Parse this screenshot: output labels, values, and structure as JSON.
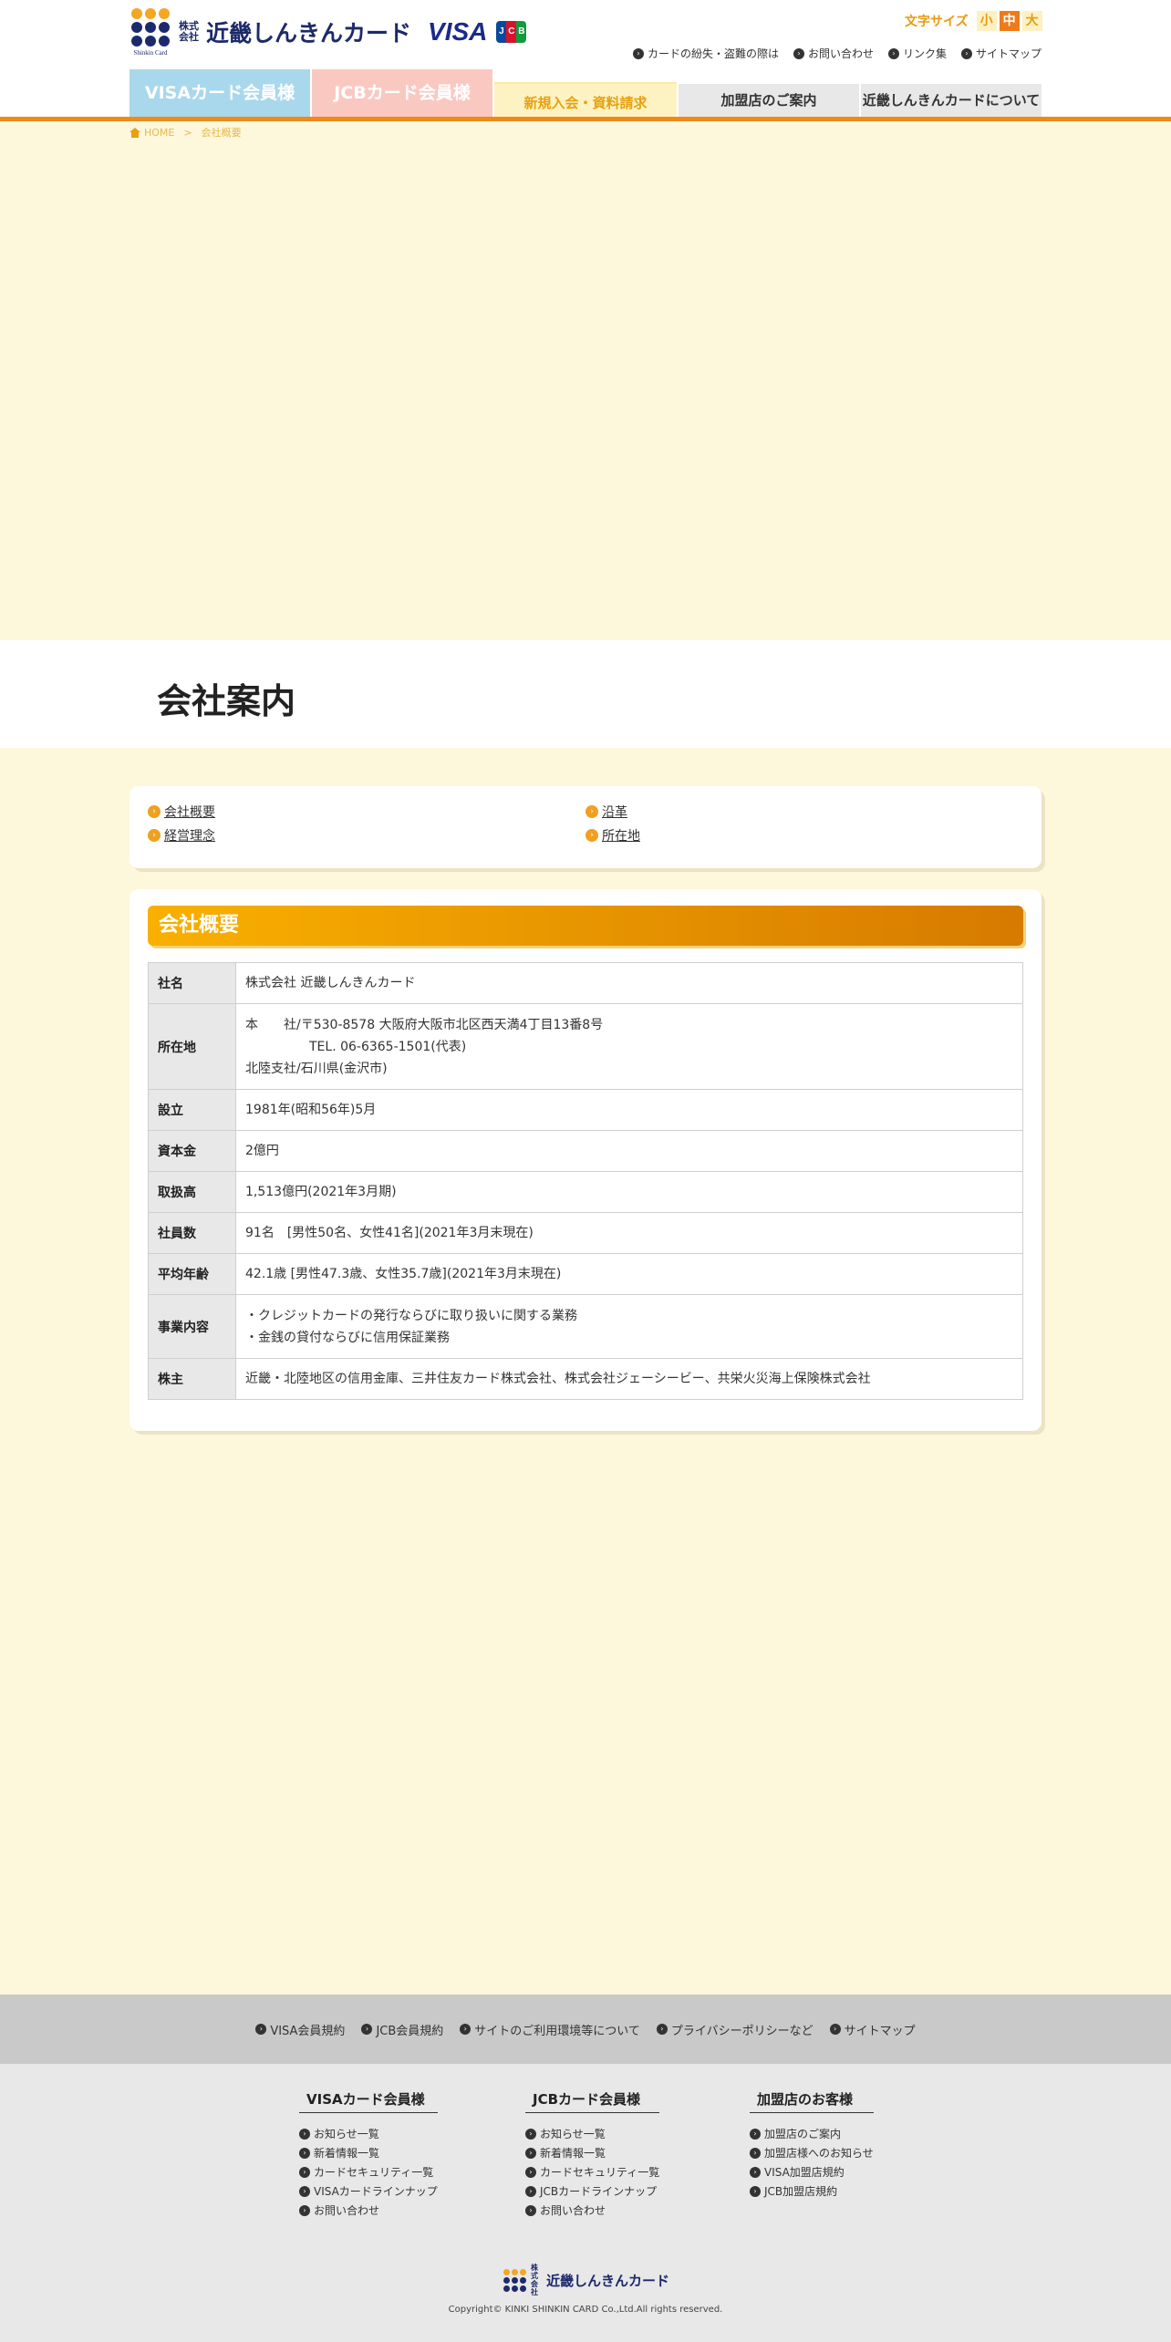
{
  "header": {
    "logo_kaisha": "株式会社",
    "logo_name": "近畿しんきんカード",
    "logo_caption": "Shinkin Card",
    "visa_logo": "VISA",
    "jcb_logo": [
      "J",
      "C",
      "B"
    ],
    "font_size": {
      "label": "文字サイズ",
      "small": "小",
      "medium": "中",
      "large": "大",
      "active": "medium"
    },
    "util_links": [
      "カードの紛失・盗難の際は",
      "お問い合わせ",
      "リンク集",
      "サイトマップ"
    ]
  },
  "nav": {
    "visa": "VISAカード会員様",
    "jcb": "JCBカード会員様",
    "new": "新規入会・資料請求",
    "store": "加盟店のご案内",
    "about": "近畿しんきんカードについて"
  },
  "breadcrumb": {
    "home": "HOME",
    "sep": ">",
    "current": "会社概要"
  },
  "page_title": "会社案内",
  "anchors": [
    "会社概要",
    "沿革",
    "経営理念",
    "所在地"
  ],
  "section": {
    "title": "会社概要",
    "rows": [
      {
        "label": "社名",
        "lines": [
          "株式会社 近畿しんきんカード"
        ]
      },
      {
        "label": "所在地",
        "lines": [
          "本　　社/〒530-8578 大阪府大阪市北区西天満4丁目13番8号",
          "TEL. 06-6365-1501(代表)",
          "北陸支社/石川県(金沢市)"
        ]
      },
      {
        "label": "設立",
        "lines": [
          "1981年(昭和56年)5月"
        ]
      },
      {
        "label": "資本金",
        "lines": [
          "2億円"
        ]
      },
      {
        "label": "取扱高",
        "lines": [
          "1,513億円(2021年3月期)"
        ]
      },
      {
        "label": "社員数",
        "lines": [
          "91名　[男性50名、女性41名](2021年3月末現在)"
        ]
      },
      {
        "label": "平均年齢",
        "lines": [
          "42.1歳 [男性47.3歳、女性35.7歳](2021年3月末現在)"
        ]
      },
      {
        "label": "事業内容",
        "lines": [
          "・クレジットカードの発行ならびに取り扱いに関する業務",
          "・金銭の貸付ならびに信用保証業務"
        ]
      },
      {
        "label": "株主",
        "lines": [
          "近畿・北陸地区の信用金庫、三井住友カード株式会社、株式会社ジェーシービー、共栄火災海上保険株式会社"
        ]
      }
    ]
  },
  "footer": {
    "bar_links": [
      "VISA会員規約",
      "JCB会員規約",
      "サイトのご利用環境等について",
      "プライバシーポリシーなど",
      "サイトマップ"
    ],
    "columns": [
      {
        "title": "VISAカード会員様",
        "items": [
          "お知らせ一覧",
          "新着情報一覧",
          "カードセキュリティ一覧",
          "VISAカードラインナップ",
          "お問い合わせ"
        ]
      },
      {
        "title": "JCBカード会員様",
        "items": [
          "お知らせ一覧",
          "新着情報一覧",
          "カードセキュリティ一覧",
          "JCBカードラインナップ",
          "お問い合わせ"
        ]
      },
      {
        "title": "加盟店のお客様",
        "items": [
          "加盟店のご案内",
          "加盟店様へのお知らせ",
          "VISA加盟店規約",
          "JCB加盟店規約"
        ]
      }
    ],
    "logo_kaisha": "株式会社",
    "logo_name": "近畿しんきんカード",
    "copyright": "Copyright© KINKI SHINKIN CARD Co.,Ltd.All rights reserved."
  },
  "colors": {
    "accent": "#ee8a1a",
    "background": "#fdf7dc",
    "visa_tab": "#a9d8ec",
    "jcb_tab": "#f9c9c1",
    "navy": "#1c2a6b"
  },
  "icons": {
    "util_link": "arrow-circle-icon",
    "home": "home-icon"
  }
}
